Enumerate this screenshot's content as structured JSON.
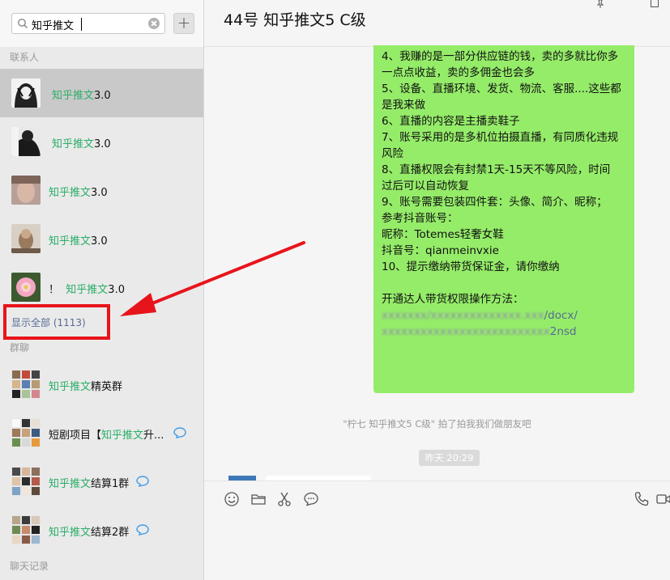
{
  "search": {
    "value": "知乎推文"
  },
  "sections": {
    "contacts": "联系人",
    "groups": "群聊",
    "history": "聊天记录"
  },
  "contacts": [
    {
      "prefix": "",
      "highlight": "知乎推文",
      "suffix": "3.0"
    },
    {
      "prefix": "",
      "highlight": "知乎推文",
      "suffix": "3.0"
    },
    {
      "prefix": "",
      "highlight": "知乎推文",
      "suffix": "3.0"
    },
    {
      "prefix": "",
      "highlight": "知乎推文",
      "suffix": "3.0"
    },
    {
      "prefix": "！",
      "highlight": "知乎推文",
      "suffix": "3.0"
    }
  ],
  "show_all": "显示全部 (1113)",
  "groups": [
    {
      "prefix": "",
      "highlight": "知乎推文",
      "suffix": "精英群"
    },
    {
      "prefix": "短剧项目【",
      "highlight": "知乎推文",
      "suffix": "升..."
    },
    {
      "prefix": "",
      "highlight": "知乎推文",
      "suffix": "结算1群"
    },
    {
      "prefix": "",
      "highlight": "知乎推文",
      "suffix": "结算2群"
    }
  ],
  "chat": {
    "title": "44号 知乎推文5 C级",
    "message_lines": [
      "4、我赚的是一部分供应链的钱，卖的多就比你多",
      "一点点收益，卖的多佣金也会多",
      "5、设备、直播环境、发货、物流、客服....这些都",
      "是我来做",
      "6、直播的内容是主播卖鞋子",
      "7、账号采用的是多机位拍摄直播，有同质化违规",
      "风险",
      "8、直播权限会有封禁1天-15天不等风险，时间",
      "过后可以自动恢复",
      "9、账号需要包装四件套：头像、简介、昵称；",
      "参考抖音账号：",
      "昵称：Totemes轻奢女鞋",
      "抖音号：qianmeinvxie",
      "10、提示缴纳带货保证金，请你缴纳",
      "",
      "开通达人带货权限操作方法："
    ],
    "link_tail_1": "/docx/",
    "link_tail_2": "2nsd",
    "system_message": "\"柠七 知乎推文5 C级\" 拍了拍我我们做朋友吧",
    "timestamp": "昨天 20:29"
  },
  "colors": {
    "highlight": "#2aae67",
    "bubble": "#95ec69",
    "annotation": "#e8141b",
    "link": "#576b95"
  }
}
